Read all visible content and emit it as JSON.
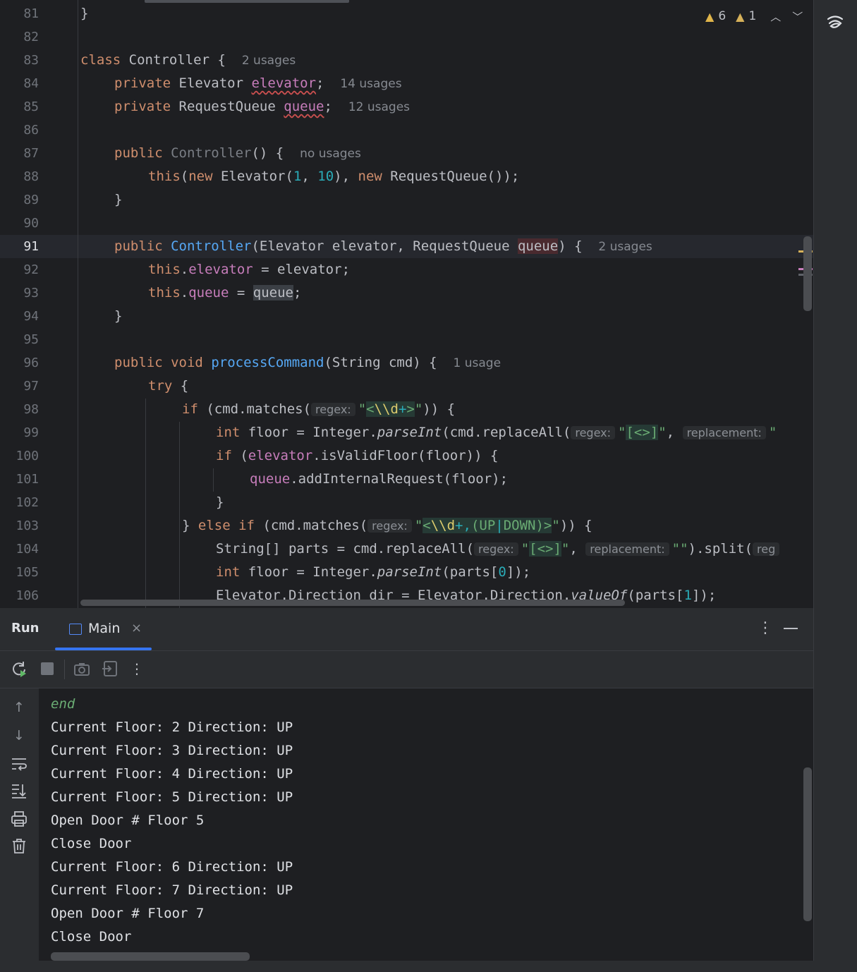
{
  "editor": {
    "current_line": 91,
    "inspections": {
      "warnings": "6",
      "weak_warnings": "1"
    },
    "lines": [
      {
        "n": "81"
      },
      {
        "n": "82"
      },
      {
        "n": "83"
      },
      {
        "n": "84"
      },
      {
        "n": "85"
      },
      {
        "n": "86"
      },
      {
        "n": "87"
      },
      {
        "n": "88"
      },
      {
        "n": "89"
      },
      {
        "n": "90"
      },
      {
        "n": "91"
      },
      {
        "n": "92"
      },
      {
        "n": "93"
      },
      {
        "n": "94"
      },
      {
        "n": "95"
      },
      {
        "n": "96"
      },
      {
        "n": "97"
      },
      {
        "n": "98"
      },
      {
        "n": "99"
      },
      {
        "n": "100"
      },
      {
        "n": "101"
      },
      {
        "n": "102"
      },
      {
        "n": "103"
      },
      {
        "n": "104"
      },
      {
        "n": "105"
      },
      {
        "n": "106"
      }
    ],
    "code": {
      "l81": "}",
      "l83": {
        "kw": "class",
        "name": "Controller {",
        "hint": "2 usages"
      },
      "l84": {
        "kw": "private",
        "type": "Elevator",
        "field": "elevator",
        "semi": ";",
        "hint": "14 usages"
      },
      "l85": {
        "kw": "private",
        "type": "RequestQueue",
        "field": "queue",
        "semi": ";",
        "hint": "12 usages"
      },
      "l87": {
        "kw": "public",
        "name": "Controller",
        "rest": "() {",
        "hint": "no usages"
      },
      "l88": {
        "this": "this",
        "p1": "(",
        "new1": "new",
        "t1": " Elevator(",
        "n1": "1",
        "c": ", ",
        "n2": "10",
        "p2": "), ",
        "new2": "new",
        "t2": " RequestQueue());"
      },
      "l89": "}",
      "l91": {
        "kw": "public",
        "name": "Controller",
        "p1": "(Elevator elevator, RequestQueue ",
        "param": "queue",
        "p2": ") {",
        "hint": "2 usages"
      },
      "l92": {
        "this": "this",
        "dot": ".",
        "field": "elevator",
        "rest": " = elevator;"
      },
      "l93": {
        "this": "this",
        "dot": ".",
        "field": "queue",
        "eq": " = ",
        "val": "queue",
        "semi": ";"
      },
      "l94": "}",
      "l96": {
        "kw1": "public",
        "kw2": "void",
        "name": "processCommand",
        "rest": "(String cmd) {",
        "hint": "1 usage"
      },
      "l97": {
        "kw": "try",
        "rest": " {"
      },
      "l98": {
        "kw": "if",
        "p1": " (cmd.matches(",
        "pill": "regex:",
        "q1": "\"",
        "rx1": "<",
        "rx2": "\\\\d",
        "rx3": "+",
        "rx4": ">",
        "q2": "\"",
        "p2": ")) {"
      },
      "l99": {
        "kw": "int",
        "p1": " floor = Integer.",
        "st": "parseInt",
        "p2": "(cmd.replaceAll(",
        "pill1": "regex:",
        "q1": "\"",
        "rx": "[<>]",
        "q2": "\"",
        "c": ", ",
        "pill2": "replacement:",
        "q3": "\""
      },
      "l100": {
        "kw": "if",
        "p1": " (",
        "field": "elevator",
        "p2": ".isValidFloor(floor)) {"
      },
      "l101": {
        "field": "queue",
        "rest": ".addInternalRequest(floor);"
      },
      "l102": "}",
      "l103": {
        "p0": "} ",
        "kw1": "else",
        "sp": " ",
        "kw2": "if",
        "p1": " (cmd.matches(",
        "pill": "regex:",
        "q1": "\"",
        "rx1": "<",
        "rx2": "\\\\d",
        "rx3": "+,",
        "rx4": "(UP",
        "rx5": "|",
        "rx6": "DOWN)",
        "rx7": ">",
        "q2": "\"",
        "p2": ")) {"
      },
      "l104": {
        "p1": "String[] parts = cmd.replaceAll(",
        "pill1": "regex:",
        "q1": "\"",
        "rx": "[<>]",
        "q2": "\"",
        "c": ", ",
        "pill2": "replacement:",
        "q3": "\"\"",
        "p2": ").split(",
        "pill3": "reg"
      },
      "l105": {
        "kw": "int",
        "p1": " floor = Integer.",
        "st": "parseInt",
        "p2": "(parts[",
        "n": "0",
        "p3": "]);"
      },
      "l106": {
        "p1": "Elevator.Direction dir = Elevator.Direction.",
        "st": "valueOf",
        "p2": "(parts[",
        "n": "1",
        "p3": "]);"
      }
    }
  },
  "run_panel": {
    "title": "Run",
    "tab_label": "Main",
    "tab_close": "×",
    "more": "⋮",
    "output": [
      {
        "text": "end",
        "input": true
      },
      {
        "text": "Current Floor: 2 Direction: UP"
      },
      {
        "text": "Current Floor: 3 Direction: UP"
      },
      {
        "text": "Current Floor: 4 Direction: UP"
      },
      {
        "text": "Current Floor: 5 Direction: UP"
      },
      {
        "text": "Open Door # Floor 5"
      },
      {
        "text": "Close Door"
      },
      {
        "text": "Current Floor: 6 Direction: UP"
      },
      {
        "text": "Current Floor: 7 Direction: UP"
      },
      {
        "text": "Open Door # Floor 7"
      },
      {
        "text": "Close Door"
      }
    ]
  },
  "colors": {
    "background": "#1e1f22",
    "keyword": "#cf8e6d",
    "field": "#c77dbb",
    "number": "#2aacb8",
    "string": "#6aab73",
    "function": "#56a8f5",
    "accent": "#3574f0"
  },
  "icons": [
    "warning-icon",
    "chevron-up-icon",
    "chevron-down-icon",
    "ai-assistant-icon",
    "rerun-icon",
    "stop-icon",
    "camera-icon",
    "exit-icon",
    "more-icon",
    "arrow-up-icon",
    "arrow-down-icon",
    "soft-wrap-icon",
    "scroll-to-end-icon",
    "print-icon",
    "trash-icon",
    "minimize-icon",
    "close-icon"
  ]
}
